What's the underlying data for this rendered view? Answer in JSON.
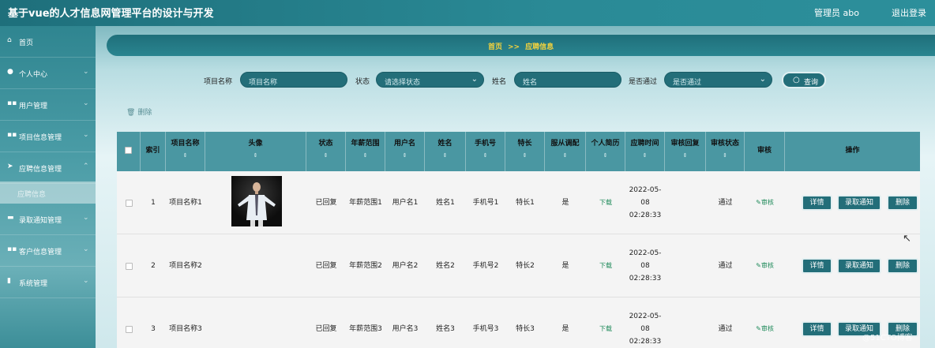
{
  "header": {
    "title": "基于vue的人才信息网管理平台的设计与开发",
    "admin": "管理员 abo",
    "logout": "退出登录"
  },
  "sidebar": {
    "items": [
      {
        "label": "首页",
        "icon": "home-icon"
      },
      {
        "label": "个人中心",
        "icon": "user-icon"
      },
      {
        "label": "用户管理",
        "icon": "grid-icon"
      },
      {
        "label": "项目信息管理",
        "icon": "grid-icon"
      },
      {
        "label": "应聘信息管理",
        "icon": "send-icon"
      },
      {
        "label": "录取通知管理",
        "icon": "card-icon"
      },
      {
        "label": "客户信息管理",
        "icon": "grid-icon"
      },
      {
        "label": "系统管理",
        "icon": "bar-chart-icon"
      }
    ],
    "active_sub": "应聘信息"
  },
  "breadcrumb": {
    "home": "首页",
    "sep": ">>",
    "current": "应聘信息"
  },
  "search": {
    "project_label": "项目名称",
    "project_placeholder": "项目名称",
    "status_label": "状态",
    "status_placeholder": "请选择状态",
    "name_label": "姓名",
    "name_placeholder": "姓名",
    "pass_label": "是否通过",
    "pass_placeholder": "是否通过",
    "button": "查询"
  },
  "toolbar": {
    "delete": "删除"
  },
  "table": {
    "headers": [
      "索引",
      "项目名称",
      "头像",
      "状态",
      "年薪范围",
      "用户名",
      "姓名",
      "手机号",
      "特长",
      "服从调配",
      "个人简历",
      "应聘时间",
      "审核回复",
      "审核状态",
      "审核",
      "操作"
    ],
    "rows": [
      {
        "index": "1",
        "project": "项目名称1",
        "status": "已回复",
        "salary": "年薪范围1",
        "username": "用户名1",
        "name": "姓名1",
        "phone": "手机号1",
        "skill": "特长1",
        "obey": "是",
        "resume": "下载",
        "time": "2022-05-08 02:28:33",
        "reply": "",
        "review_status": "通过",
        "review": "审核"
      },
      {
        "index": "2",
        "project": "项目名称2",
        "status": "已回复",
        "salary": "年薪范围2",
        "username": "用户名2",
        "name": "姓名2",
        "phone": "手机号2",
        "skill": "特长2",
        "obey": "是",
        "resume": "下载",
        "time": "2022-05-08 02:28:33",
        "reply": "",
        "review_status": "通过",
        "review": "审核"
      },
      {
        "index": "3",
        "project": "项目名称3",
        "status": "已回复",
        "salary": "年薪范围3",
        "username": "用户名3",
        "name": "姓名3",
        "phone": "手机号3",
        "skill": "特长3",
        "obey": "是",
        "resume": "下载",
        "time": "2022-05-08 02:28:33",
        "reply": "",
        "review_status": "通过",
        "review": "审核"
      }
    ],
    "actions": {
      "detail": "详情",
      "notify": "录取通知",
      "delete": "删除"
    }
  },
  "watermark": "@51CTO博客",
  "colors": {
    "accent": "#236e79",
    "header": "#1e6f7b",
    "table_head": "#4a97a2",
    "breadcrumb_text": "#f3d23d"
  }
}
